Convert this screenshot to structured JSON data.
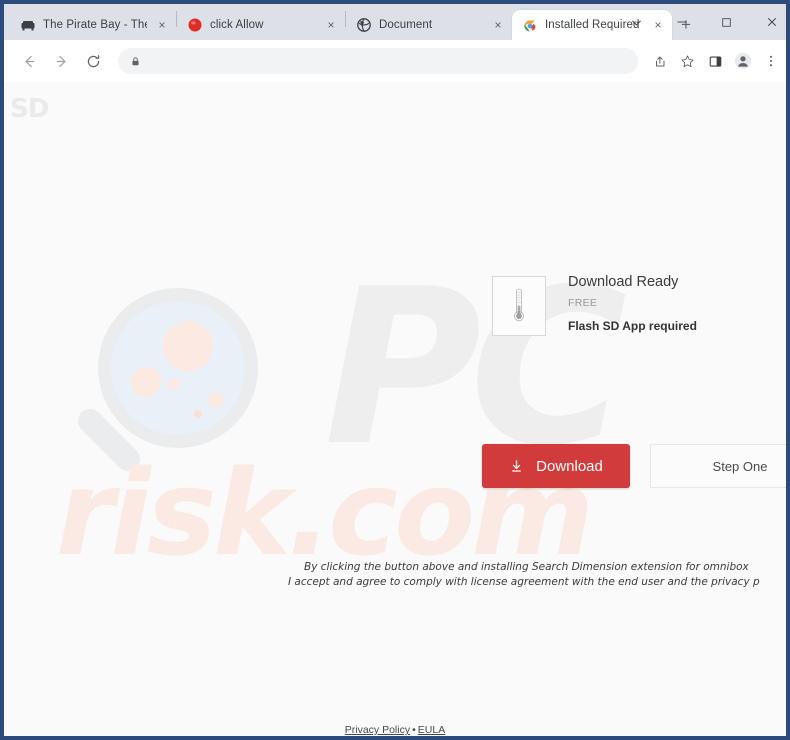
{
  "browser": {
    "tabs": [
      {
        "title": "The Pirate Bay - The gala",
        "favicon": "piratebay-icon",
        "active": false,
        "close_label": "×"
      },
      {
        "title": "click Allow",
        "favicon": "red-circle-icon",
        "active": false,
        "close_label": "×"
      },
      {
        "title": "Document",
        "favicon": "globe-icon",
        "active": false,
        "close_label": "×"
      },
      {
        "title": "Installed Required",
        "favicon": "chrome-icon",
        "active": true,
        "close_label": "×"
      }
    ],
    "new_tab_label": "+",
    "window_controls": {
      "tab_search_label": "⌄",
      "minimize_label": "–",
      "maximize_label": "□",
      "close_label": "✕"
    },
    "toolbar": {
      "back_label": "←",
      "forward_label": "→",
      "reload_label": "⟳",
      "site_info_icon": "lock-icon",
      "address_value": "",
      "address_placeholder": "",
      "share_icon": "share-icon",
      "bookmark_icon": "star-icon",
      "sidepanel_icon": "side-panel-icon",
      "profile_icon": "profile-icon",
      "menu_icon": "three-dot-menu-icon"
    }
  },
  "page": {
    "brand_logo": "SD",
    "watermarks": {
      "pc": "PC",
      "risk": "risk.com"
    },
    "download": {
      "thumb_icon": "thermometer-icon",
      "title": "Download Ready",
      "price": "FREE",
      "requirement": "Flash SD App required",
      "button_label": "Download",
      "button_icon": "download-arrow-icon",
      "button_color": "#d23b3b",
      "step_label": "Step One"
    },
    "disclaimer": {
      "line1": "By clicking the button above and installing Search Dimension extension for omnibox",
      "line2": "I accept and agree to comply with license agreement with the end user and the privacy p"
    },
    "footer": {
      "privacy_label": "Privacy Policy",
      "separator": "•",
      "eula_label": "EULA"
    }
  }
}
